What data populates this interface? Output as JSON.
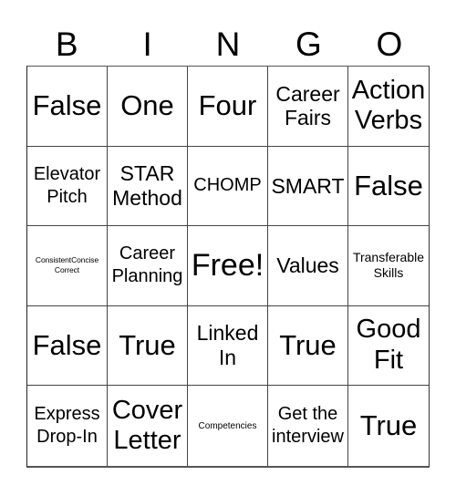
{
  "header": {
    "letters": [
      "B",
      "I",
      "N",
      "G",
      "O"
    ]
  },
  "card": {
    "rows": [
      [
        {
          "text": "False",
          "size": "xl"
        },
        {
          "text": "One",
          "size": "xl"
        },
        {
          "text": "Four",
          "size": "xl"
        },
        {
          "text": "Career Fairs",
          "size": "m"
        },
        {
          "text": "Action Verbs",
          "size": "l"
        }
      ],
      [
        {
          "text": "Elevator Pitch",
          "size": "s"
        },
        {
          "text": "STAR Method",
          "size": "m"
        },
        {
          "text": "CHOMP",
          "size": "s"
        },
        {
          "text": "SMART",
          "size": "m"
        },
        {
          "text": "False",
          "size": "xl"
        }
      ],
      [
        {
          "text": "ConsistentConcise Correct",
          "size": "xxxs"
        },
        {
          "text": "Career Planning",
          "size": "s"
        },
        {
          "text": "Free!",
          "size": "free"
        },
        {
          "text": "Values",
          "size": "m"
        },
        {
          "text": "Transferable Skills",
          "size": "xs"
        }
      ],
      [
        {
          "text": "False",
          "size": "xl"
        },
        {
          "text": "True",
          "size": "xl"
        },
        {
          "text": "Linked In",
          "size": "m"
        },
        {
          "text": "True",
          "size": "xl"
        },
        {
          "text": "Good Fit",
          "size": "l"
        }
      ],
      [
        {
          "text": "Express Drop-In",
          "size": "s"
        },
        {
          "text": "Cover Letter",
          "size": "l"
        },
        {
          "text": "Competencies",
          "size": "xxs"
        },
        {
          "text": "Get the interview",
          "size": "s"
        },
        {
          "text": "True",
          "size": "xl"
        }
      ]
    ]
  }
}
